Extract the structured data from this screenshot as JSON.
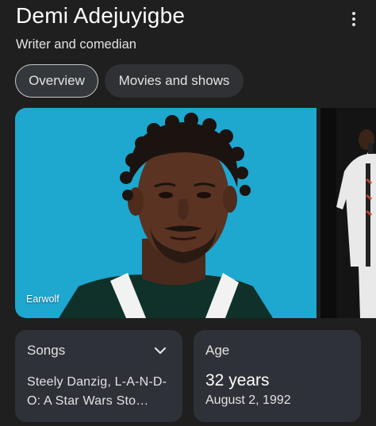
{
  "header": {
    "name": "Demi Adejuyigbe",
    "subtitle": "Writer and comedian",
    "more_icon": "more-vert-icon"
  },
  "tabs": [
    {
      "label": "Overview",
      "selected": true
    },
    {
      "label": "Movies and shows",
      "selected": false
    }
  ],
  "images": {
    "primary_caption": "Earwolf"
  },
  "cards": {
    "songs": {
      "label": "Songs",
      "text": "Steely Danzig, L-A-N-D-O: A Star Wars Sto…",
      "icon": "chevron-down-icon"
    },
    "age": {
      "label": "Age",
      "value": "32 years",
      "date": "August 2, 1992"
    }
  },
  "colors": {
    "background": "#1f1f1f",
    "card": "#2f3138",
    "photo_background": "#1ea7cf"
  }
}
